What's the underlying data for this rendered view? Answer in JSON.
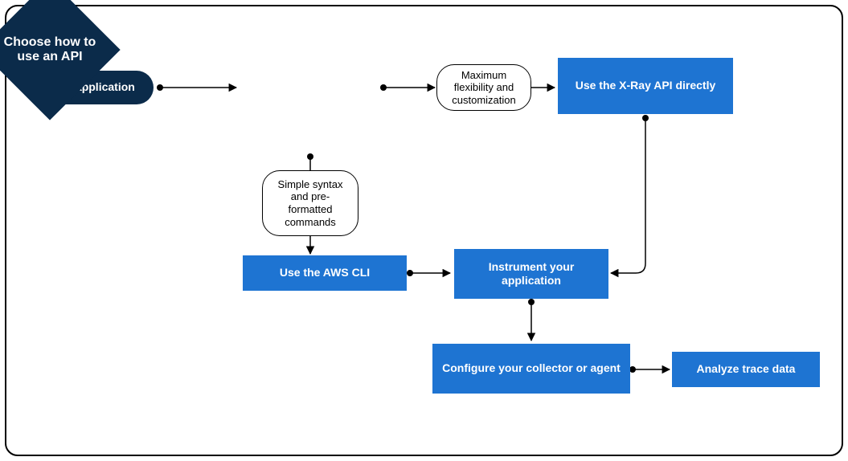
{
  "diagram": {
    "nodes": {
      "start": "Your application",
      "decision": "Choose how to use an API",
      "label_flex": "Maximum flexibility and customization",
      "label_simple": "Simple syntax and pre-formatted commands",
      "use_api": "Use the X-Ray API directly",
      "use_cli": "Use the AWS CLI",
      "instrument": "Instrument your application",
      "configure": "Configure your collector or agent",
      "analyze": "Analyze trace data"
    }
  }
}
